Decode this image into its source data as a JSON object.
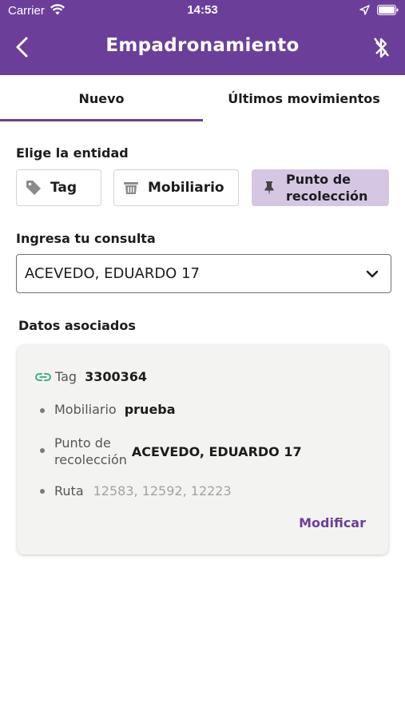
{
  "status_bar": {
    "carrier": "Carrier",
    "time": "14:53"
  },
  "nav": {
    "title": "Empadronamiento"
  },
  "tabs": [
    {
      "label": "Nuevo"
    },
    {
      "label": "Últimos movimientos"
    }
  ],
  "entity": {
    "label": "Elige la entidad",
    "options": [
      {
        "label": "Tag",
        "icon": "tag-icon"
      },
      {
        "label": "Mobiliario",
        "icon": "bin-icon"
      },
      {
        "label": "Punto de recolección",
        "icon": "pin-icon"
      }
    ],
    "selected": "Punto de recolección"
  },
  "query": {
    "label": "Ingresa tu consulta",
    "value": "ACEVEDO, EDUARDO 17"
  },
  "associated": {
    "label": "Datos asociados",
    "tag": {
      "key": "Tag",
      "value": "3300364"
    },
    "mobiliario": {
      "key": "Mobiliario",
      "value": "prueba"
    },
    "punto": {
      "key_line1": "Punto de",
      "key_line2": "recolección",
      "value": "ACEVEDO, EDUARDO 17"
    },
    "ruta": {
      "key": "Ruta",
      "value": "12583, 12592, 12223"
    },
    "action": "Modificar"
  },
  "colors": {
    "primary": "#6b3f99",
    "selected_bg": "#d5c6e4",
    "link_icon": "#3fb08a"
  }
}
